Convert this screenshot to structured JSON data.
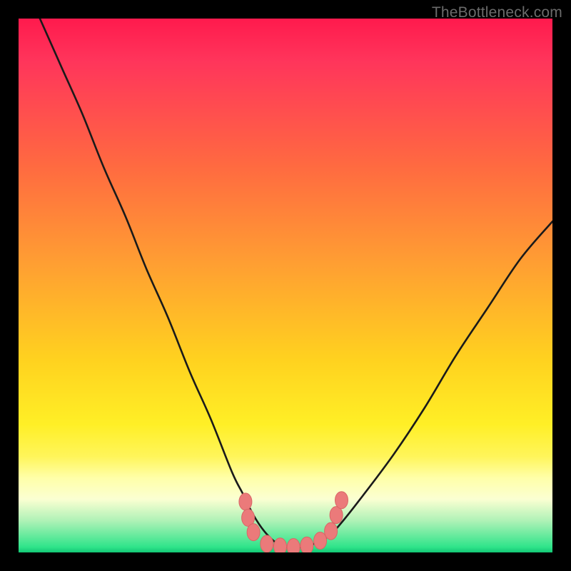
{
  "watermark": "TheBottleneck.com",
  "colors": {
    "frame": "#000000",
    "gradient_top": "#ff1a4d",
    "gradient_bottom": "#13c775",
    "curve_stroke": "#1a1a1a",
    "marker_fill": "#eb7a7a",
    "marker_stroke": "#d96666"
  },
  "chart_data": {
    "type": "line",
    "title": "",
    "xlabel": "",
    "ylabel": "",
    "xlim": [
      0,
      100
    ],
    "ylim": [
      0,
      100
    ],
    "series": [
      {
        "name": "bottleneck-curve",
        "x": [
          4,
          8,
          12,
          16,
          20,
          24,
          28,
          32,
          36,
          40,
          42,
          44,
          46,
          48,
          50,
          52,
          54,
          56,
          58,
          60,
          64,
          70,
          76,
          82,
          88,
          94,
          100
        ],
        "y": [
          100,
          91,
          82,
          72,
          63,
          53,
          44,
          34,
          25,
          15,
          11,
          7,
          4,
          2,
          1,
          1,
          1,
          2,
          3,
          5,
          10,
          18,
          27,
          37,
          46,
          55,
          62
        ]
      }
    ],
    "markers": [
      {
        "x": 42.5,
        "y": 9.5
      },
      {
        "x": 43.0,
        "y": 6.5
      },
      {
        "x": 44.0,
        "y": 3.8
      },
      {
        "x": 46.5,
        "y": 1.6
      },
      {
        "x": 49.0,
        "y": 1.1
      },
      {
        "x": 51.5,
        "y": 1.0
      },
      {
        "x": 54.0,
        "y": 1.3
      },
      {
        "x": 56.5,
        "y": 2.2
      },
      {
        "x": 58.5,
        "y": 4.0
      },
      {
        "x": 59.5,
        "y": 7.0
      },
      {
        "x": 60.5,
        "y": 9.8
      }
    ],
    "annotations": []
  }
}
